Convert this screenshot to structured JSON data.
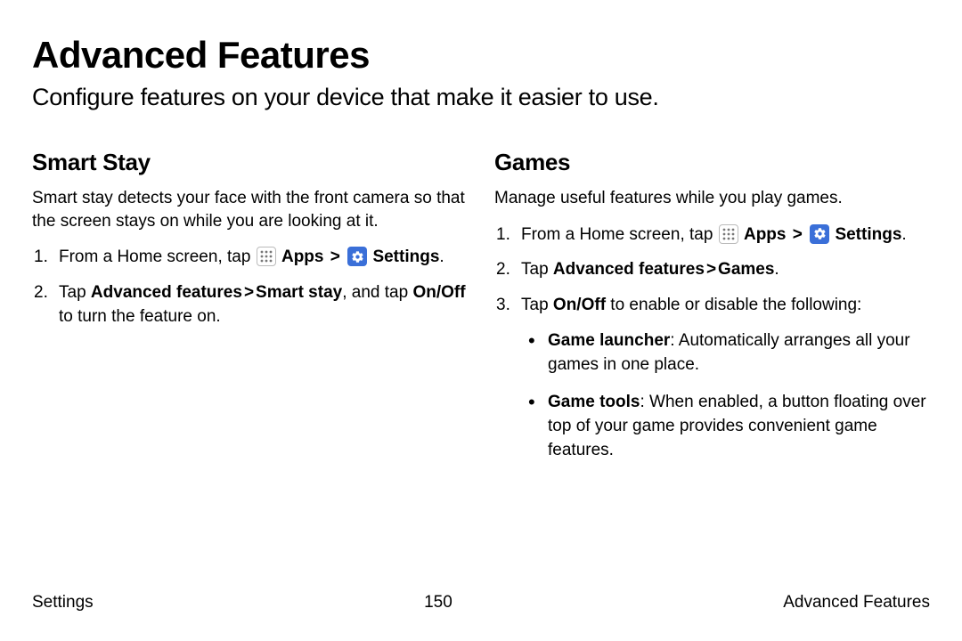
{
  "title": "Advanced Features",
  "subtitle": "Configure features on your device that make it easier to use.",
  "left": {
    "heading": "Smart Stay",
    "intro": "Smart stay detects your face with the front camera so that the screen stays on while you are looking at it.",
    "step1_prefix": "From a Home screen, tap ",
    "apps": "Apps",
    "settings": "Settings",
    "step2_a": "Tap ",
    "step2_b": "Advanced features",
    "step2_c": "Smart stay",
    "step2_d": ", and tap ",
    "step2_e": "On/Off",
    "step2_f": " to turn the feature on."
  },
  "right": {
    "heading": "Games",
    "intro": "Manage useful features while you play games.",
    "step1_prefix": "From a Home screen, tap ",
    "apps": "Apps",
    "settings": "Settings",
    "step2_a": "Tap ",
    "step2_b": "Advanced features",
    "step2_c": "Games",
    "step3_a": "Tap ",
    "step3_b": "On/Off",
    "step3_c": " to enable or disable the following:",
    "bullet1_a": "Game launcher",
    "bullet1_b": ": Automatically arranges all your games in one place.",
    "bullet2_a": "Game tools",
    "bullet2_b": ": When enabled, a button floating over top of your game provides convenient game features."
  },
  "footer": {
    "left": "Settings",
    "center": "150",
    "right": "Advanced Features"
  },
  "caret": ">"
}
